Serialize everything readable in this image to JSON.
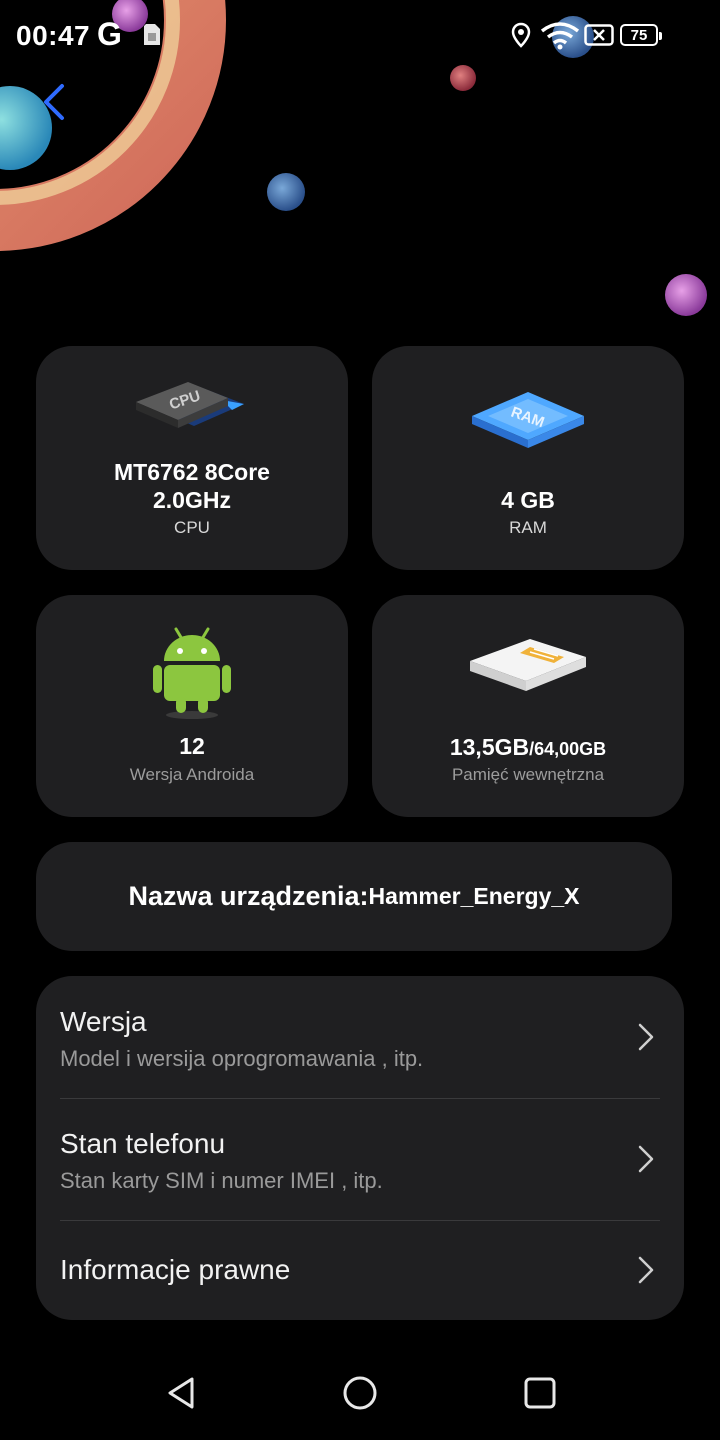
{
  "status_bar": {
    "time": "00:47",
    "network_letter": "G",
    "battery_level": "75"
  },
  "specs": {
    "cpu": {
      "value_line1": "MT6762  8Core",
      "value_line2": "2.0GHz",
      "label": "CPU",
      "chip_text": "CPU"
    },
    "ram": {
      "value": "4 GB",
      "label": "RAM",
      "chip_text": "RAM"
    },
    "android": {
      "value": "12",
      "label": "Wersja Androida"
    },
    "storage": {
      "used": "13,5GB",
      "total": "/64,00GB",
      "label": "Pamięć wewnętrzna"
    }
  },
  "device_name": {
    "label": "Nazwa urządzenia:",
    "value": "Hammer_Energy_X"
  },
  "menu": [
    {
      "title": "Wersja",
      "subtitle": "Model i wersija oprogromawania , itp."
    },
    {
      "title": "Stan telefonu",
      "subtitle": "Stan karty SIM i numer IMEI , itp."
    },
    {
      "title": "Informacje prawne"
    }
  ],
  "colors": {
    "background": "#000000",
    "card": "#1f1f21",
    "accent_back": "#2f6bff"
  },
  "icons": [
    "back-arrow-icon",
    "cpu-chip-icon",
    "ram-chip-icon",
    "android-robot-icon",
    "storage-card-icon",
    "chevron-right-icon",
    "nav-back-icon",
    "nav-home-icon",
    "nav-recents-icon"
  ]
}
